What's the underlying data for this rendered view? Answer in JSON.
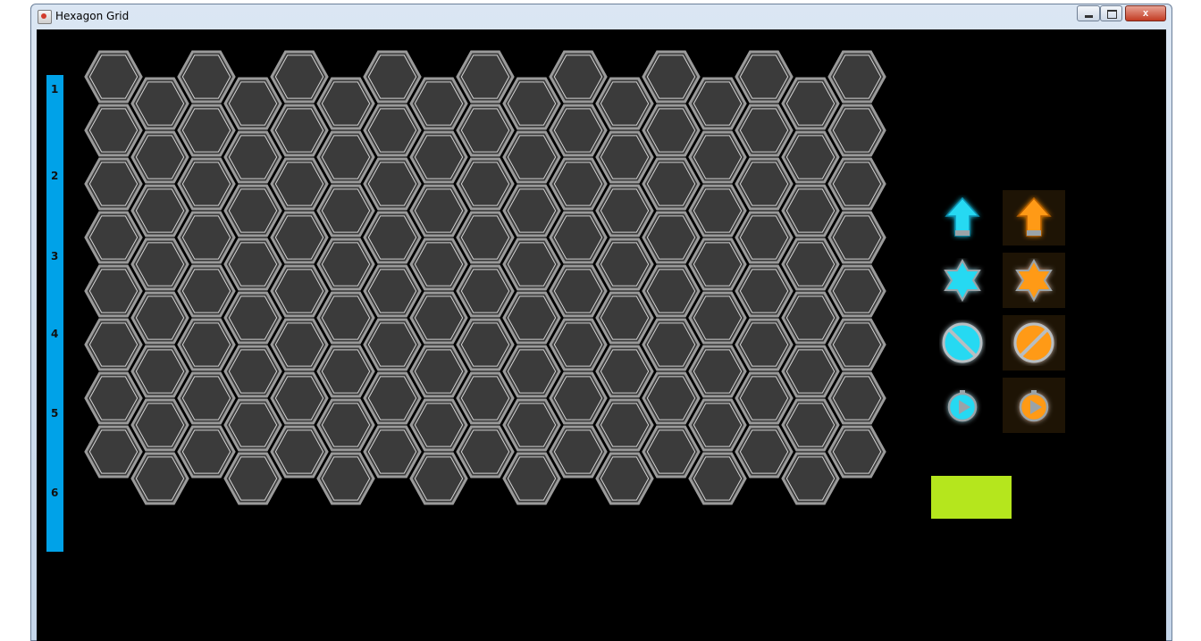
{
  "window": {
    "title": "Hexagon Grid",
    "controls": {
      "minimize": "",
      "maximize": "",
      "close": "x"
    }
  },
  "ruler": {
    "color": "#00a2e8",
    "labels": [
      "1",
      "2",
      "3",
      "4",
      "5",
      "6"
    ]
  },
  "hex_grid": {
    "columns": 17,
    "rows_even_col": 8,
    "rows_odd_col": 8,
    "fill": "#3b3b3b",
    "border": "#9a9a9a"
  },
  "tools": {
    "cyan_color": "#27d9f2",
    "orange_color": "#ff9a14",
    "items": [
      {
        "icon": "arrow-up-icon",
        "team": "cyan"
      },
      {
        "icon": "arrow-up-icon",
        "team": "orange"
      },
      {
        "icon": "star-icon",
        "team": "cyan"
      },
      {
        "icon": "star-icon",
        "team": "orange"
      },
      {
        "icon": "block-icon",
        "team": "cyan"
      },
      {
        "icon": "block-icon",
        "team": "orange"
      },
      {
        "icon": "play-icon",
        "team": "cyan"
      },
      {
        "icon": "play-icon",
        "team": "orange"
      }
    ]
  },
  "selected_color": "#b5e61d"
}
